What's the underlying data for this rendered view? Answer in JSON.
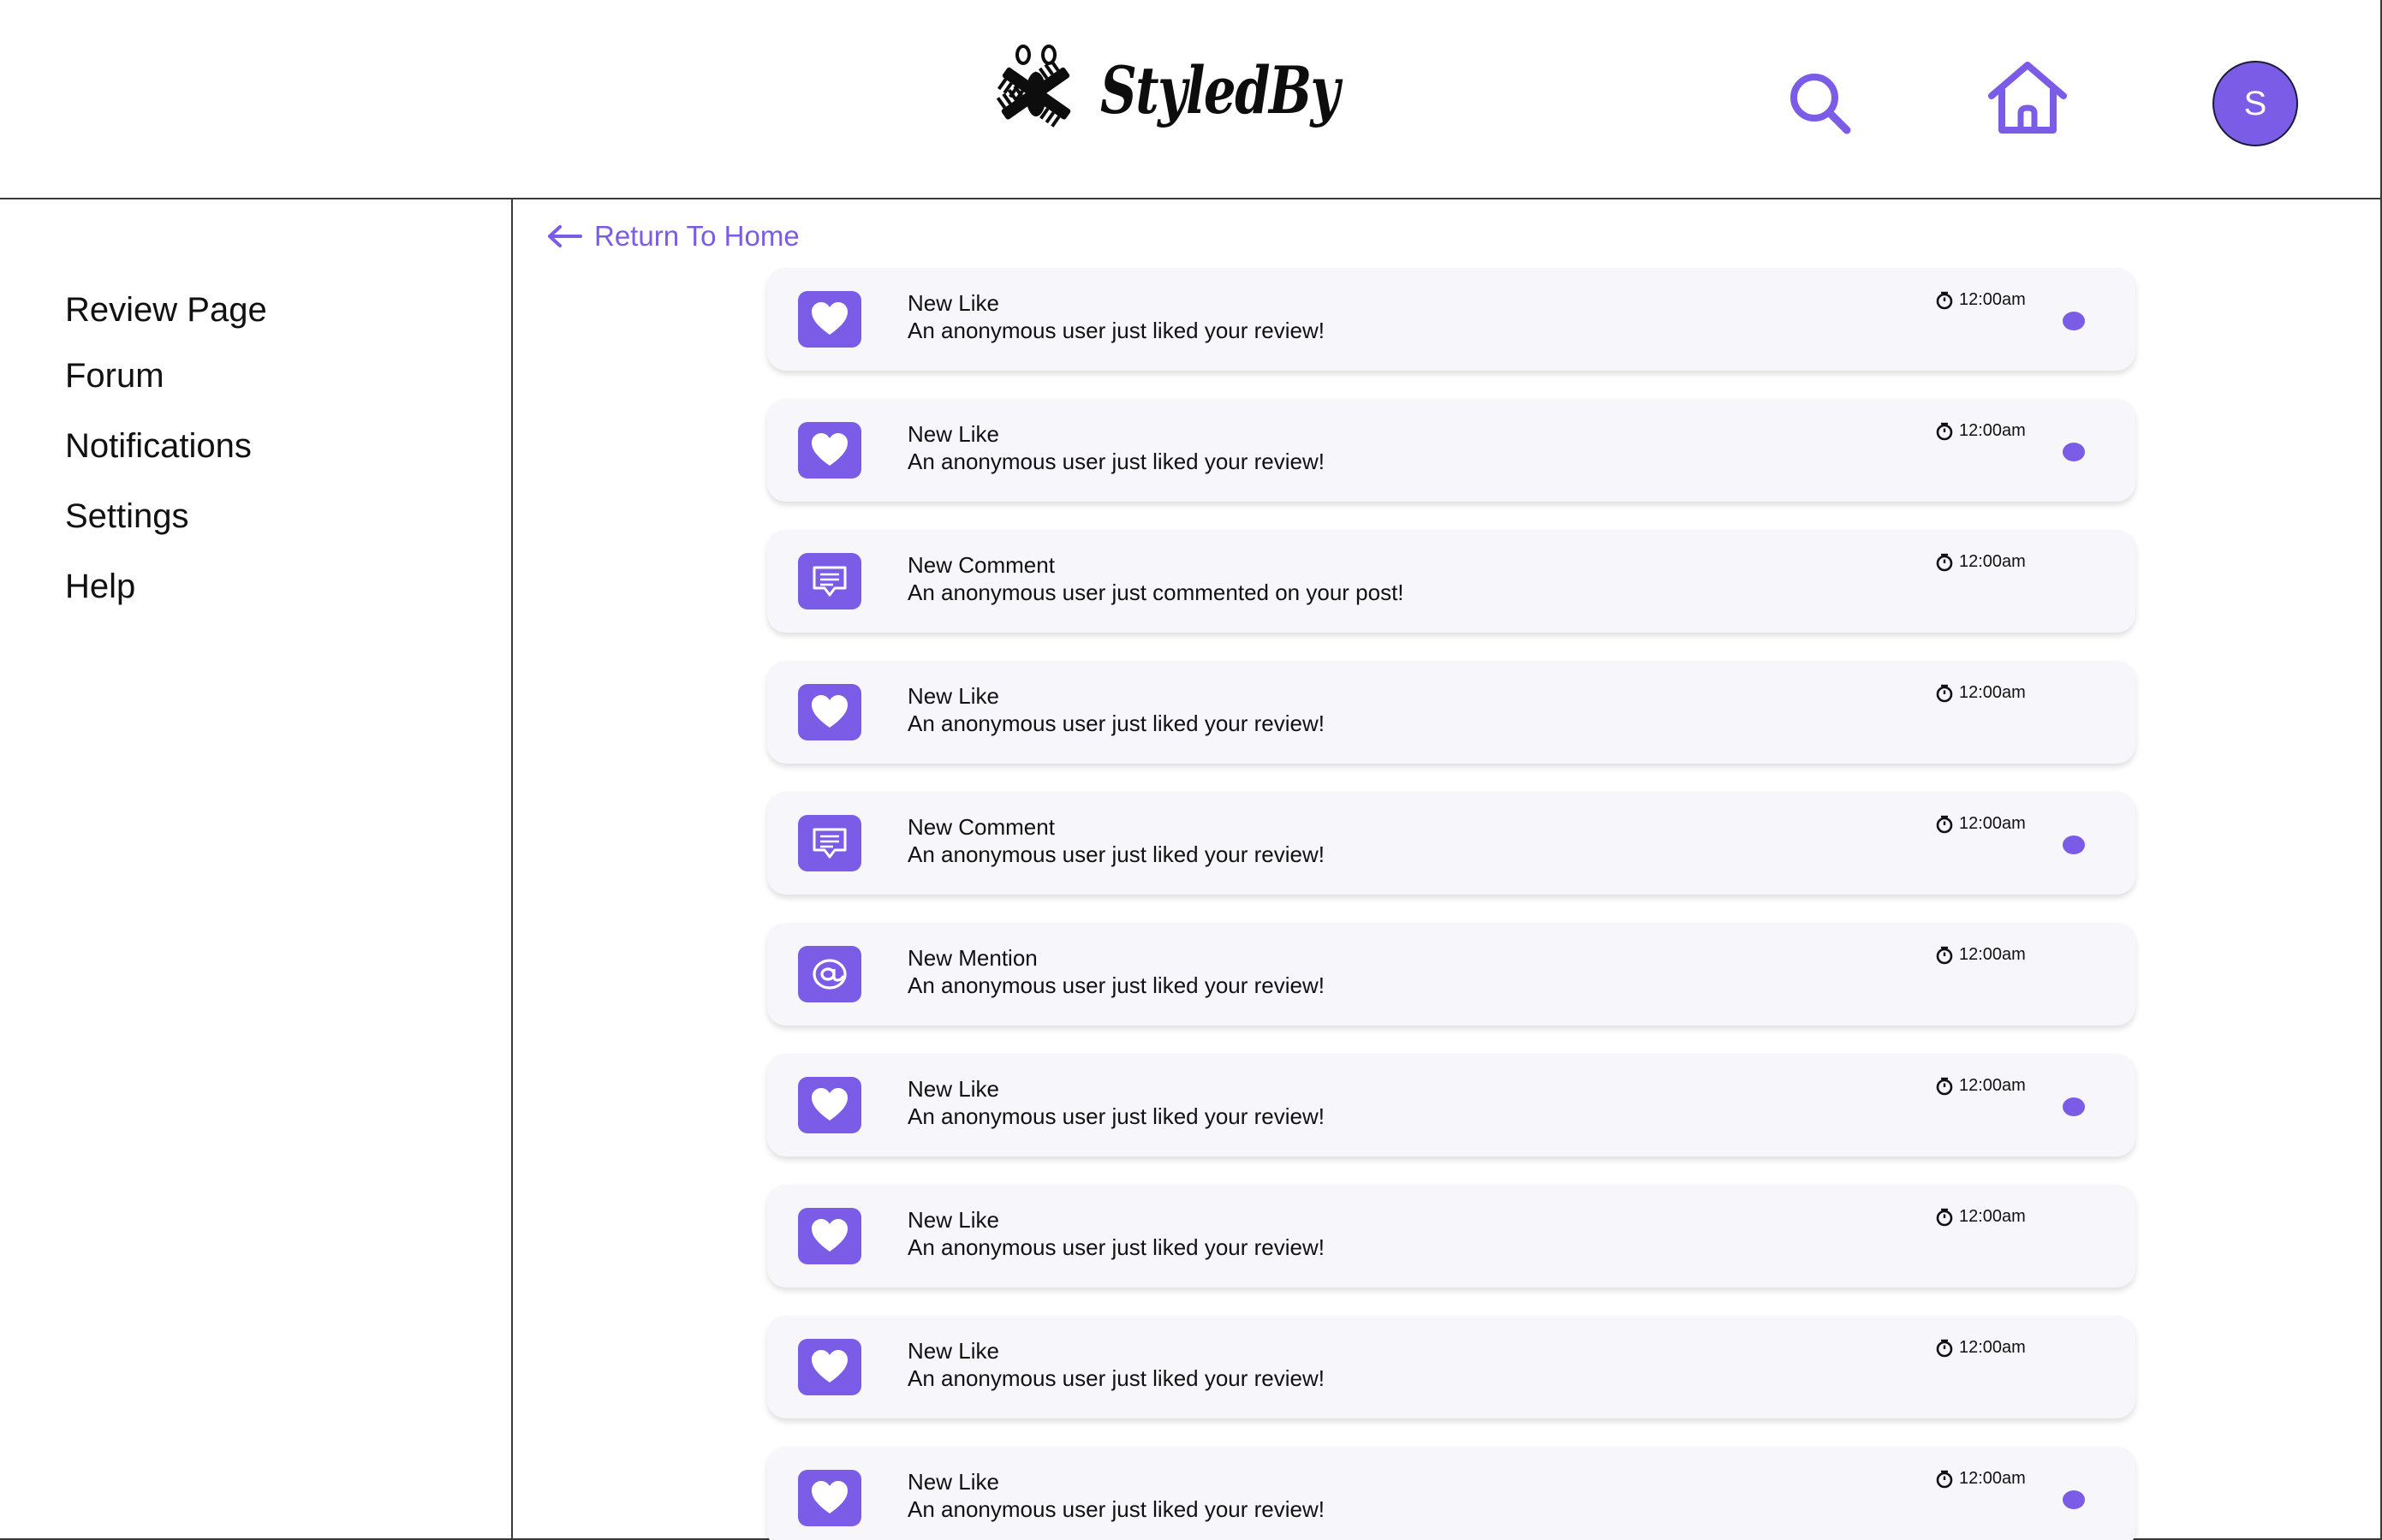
{
  "colors": {
    "accent": "#7b5ce6",
    "card_bg": "#f7f6fb",
    "border": "#3a3a3a"
  },
  "header": {
    "logo_text": "StyledBy",
    "search_icon": "search-icon",
    "home_icon": "home-icon",
    "avatar_initial": "S"
  },
  "sidebar": {
    "items": [
      {
        "label": "Review Page"
      },
      {
        "label": "Forum"
      },
      {
        "label": "Notifications"
      },
      {
        "label": "Settings"
      },
      {
        "label": "Help"
      }
    ]
  },
  "main": {
    "back_label": "Return To Home",
    "notifications": [
      {
        "type": "like",
        "icon": "heart-icon",
        "title": "New Like",
        "message": "An anonymous user just liked your review!",
        "time": "12:00am",
        "unread": true
      },
      {
        "type": "like",
        "icon": "heart-icon",
        "title": "New Like",
        "message": "An anonymous user just liked your review!",
        "time": "12:00am",
        "unread": true
      },
      {
        "type": "comment",
        "icon": "comment-icon",
        "title": "New Comment",
        "message": "An anonymous user just commented on your post!",
        "time": "12:00am",
        "unread": false
      },
      {
        "type": "like",
        "icon": "heart-icon",
        "title": "New Like",
        "message": "An anonymous user just liked your review!",
        "time": "12:00am",
        "unread": false
      },
      {
        "type": "comment",
        "icon": "comment-icon",
        "title": "New Comment",
        "message": "An anonymous user just liked your review!",
        "time": "12:00am",
        "unread": true
      },
      {
        "type": "mention",
        "icon": "at-icon",
        "title": "New Mention",
        "message": "An anonymous user just liked your review!",
        "time": "12:00am",
        "unread": false
      },
      {
        "type": "like",
        "icon": "heart-icon",
        "title": "New Like",
        "message": "An anonymous user just liked your review!",
        "time": "12:00am",
        "unread": true
      },
      {
        "type": "like",
        "icon": "heart-icon",
        "title": "New Like",
        "message": "An anonymous user just liked your review!",
        "time": "12:00am",
        "unread": false
      },
      {
        "type": "like",
        "icon": "heart-icon",
        "title": "New Like",
        "message": "An anonymous user just liked your review!",
        "time": "12:00am",
        "unread": false
      },
      {
        "type": "like",
        "icon": "heart-icon",
        "title": "New Like",
        "message": "An anonymous user just liked your review!",
        "time": "12:00am",
        "unread": true
      }
    ]
  }
}
